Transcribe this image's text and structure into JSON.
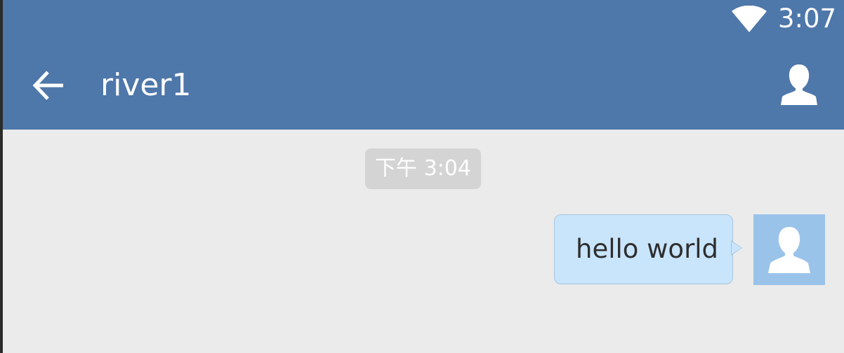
{
  "status_bar": {
    "wifi_icon": "wifi-icon",
    "time": "3:07"
  },
  "app_bar": {
    "back_icon": "arrow-left-icon",
    "title": "river1",
    "profile_icon": "person-icon"
  },
  "chat": {
    "timestamp": "下午 3:04",
    "messages": [
      {
        "direction": "outgoing",
        "text": "hello world",
        "avatar_icon": "person-icon"
      }
    ]
  },
  "colors": {
    "header": "#4e77aa",
    "background": "#ebebeb",
    "timestamp_bg": "#d4d4d4",
    "bubble": "#c8e5fc",
    "avatar": "#9ac3ea"
  }
}
